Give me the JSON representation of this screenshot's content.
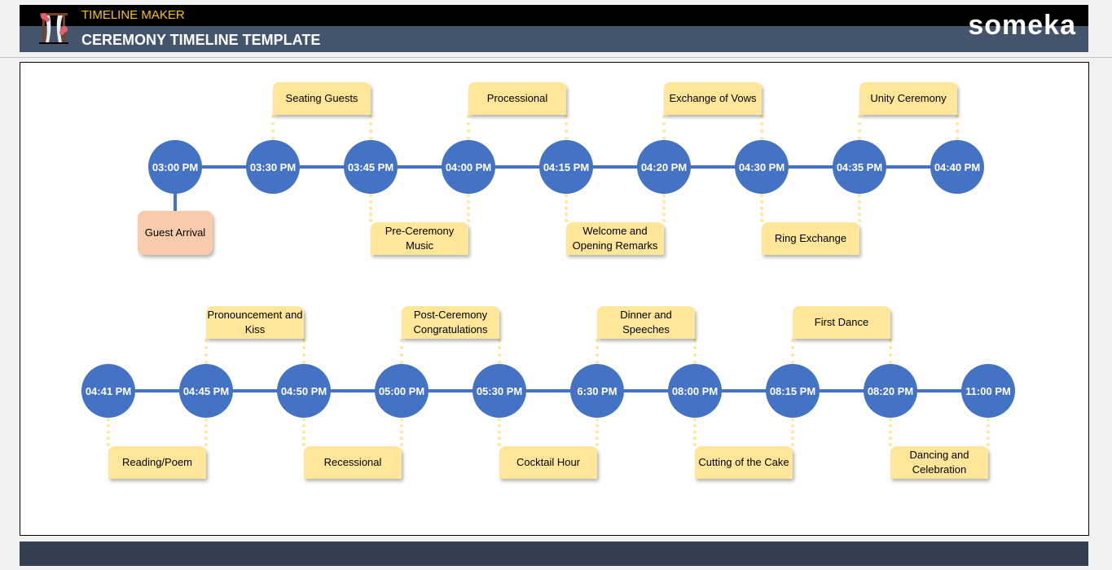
{
  "header": {
    "app_title": "TIMELINE MAKER",
    "page_title": "CEREMONY TIMELINE TEMPLATE",
    "brand": "someka",
    "logo": "ceremony-arch-icon"
  },
  "colors": {
    "circle": "#4472c4",
    "box": "#ffe699",
    "first_box": "#f8cbad",
    "header": "#44546a"
  },
  "rows": [
    {
      "times": [
        "03:00 PM",
        "03:30 PM",
        "03:45 PM",
        "04:00 PM",
        "04:15 PM",
        "04:20 PM",
        "04:30 PM",
        "04:35 PM",
        "04:40 PM"
      ],
      "first_event": "Guest Arrival",
      "events": [
        {
          "label": "Seating Guests",
          "from": 1,
          "pos": "top"
        },
        {
          "label": "Pre-Ceremony Music",
          "from": 2,
          "pos": "bottom"
        },
        {
          "label": "Processional",
          "from": 3,
          "pos": "top"
        },
        {
          "label": "Welcome and Opening Remarks",
          "from": 4,
          "pos": "bottom"
        },
        {
          "label": "Exchange of Vows",
          "from": 5,
          "pos": "top"
        },
        {
          "label": "Ring Exchange",
          "from": 6,
          "pos": "bottom"
        },
        {
          "label": "Unity Ceremony",
          "from": 7,
          "pos": "top"
        }
      ]
    },
    {
      "times": [
        "04:41 PM",
        "04:45 PM",
        "04:50 PM",
        "05:00 PM",
        "05:30 PM",
        "6:30 PM",
        "08:00 PM",
        "08:15 PM",
        "08:20 PM",
        "11:00 PM"
      ],
      "events": [
        {
          "label": "Reading/Poem",
          "from": 0,
          "pos": "bottom"
        },
        {
          "label": "Pronouncement and Kiss",
          "from": 1,
          "pos": "top"
        },
        {
          "label": "Recessional",
          "from": 2,
          "pos": "bottom"
        },
        {
          "label": "Post-Ceremony Congratulations",
          "from": 3,
          "pos": "top"
        },
        {
          "label": "Cocktail Hour",
          "from": 4,
          "pos": "bottom"
        },
        {
          "label": "Dinner and Speeches",
          "from": 5,
          "pos": "top"
        },
        {
          "label": "Cutting of the Cake",
          "from": 6,
          "pos": "bottom"
        },
        {
          "label": "First Dance",
          "from": 7,
          "pos": "top"
        },
        {
          "label": "Dancing and Celebration",
          "from": 8,
          "pos": "bottom"
        }
      ]
    }
  ]
}
